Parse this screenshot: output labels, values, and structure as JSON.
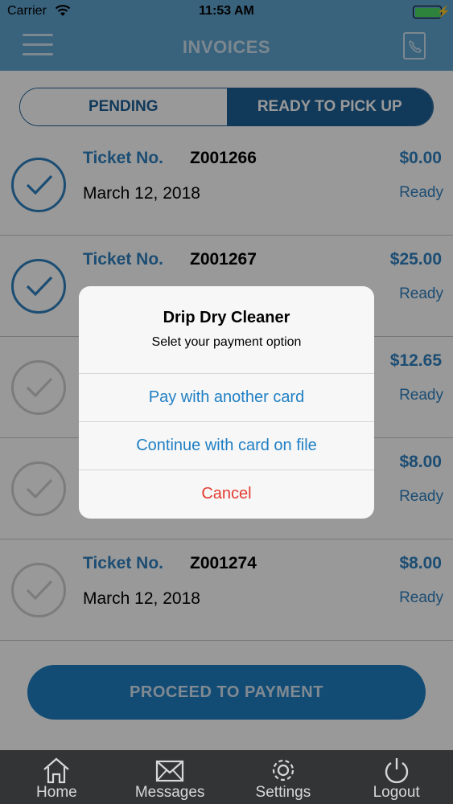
{
  "status_bar": {
    "carrier": "Carrier",
    "time": "11:53 AM"
  },
  "header": {
    "title": "INVOICES"
  },
  "segments": {
    "pending": "PENDING",
    "ready": "READY TO PICK UP"
  },
  "tickets": [
    {
      "label": "Ticket No.",
      "number": "Z001266",
      "date": "March 12, 2018",
      "amount": "$0.00",
      "status": "Ready",
      "selected": true
    },
    {
      "label": "Ticket No.",
      "number": "Z001267",
      "date": "",
      "amount": "$25.00",
      "status": "Ready",
      "selected": true
    },
    {
      "label": "",
      "number": "",
      "date": "",
      "amount": "$12.65",
      "status": "Ready",
      "selected": false
    },
    {
      "label": "",
      "number": "",
      "date": "",
      "amount": "$8.00",
      "status": "Ready",
      "selected": false
    },
    {
      "label": "Ticket No.",
      "number": "Z001274",
      "date": "March 12, 2018",
      "amount": "$8.00",
      "status": "Ready",
      "selected": false
    }
  ],
  "proceed_button": "PROCEED TO PAYMENT",
  "tab_bar": {
    "home": "Home",
    "messages": "Messages",
    "settings": "Settings",
    "logout": "Logout"
  },
  "alert": {
    "title": "Drip Dry Cleaner",
    "message": "Selet your payment option",
    "pay_another": "Pay with another card",
    "continue_on_file": "Continue with card on file",
    "cancel": "Cancel"
  },
  "colors": {
    "accent": "#2f80c0",
    "segment_active": "#1d5f96",
    "header": "#5fa3d0",
    "cancel": "#e23b30"
  }
}
